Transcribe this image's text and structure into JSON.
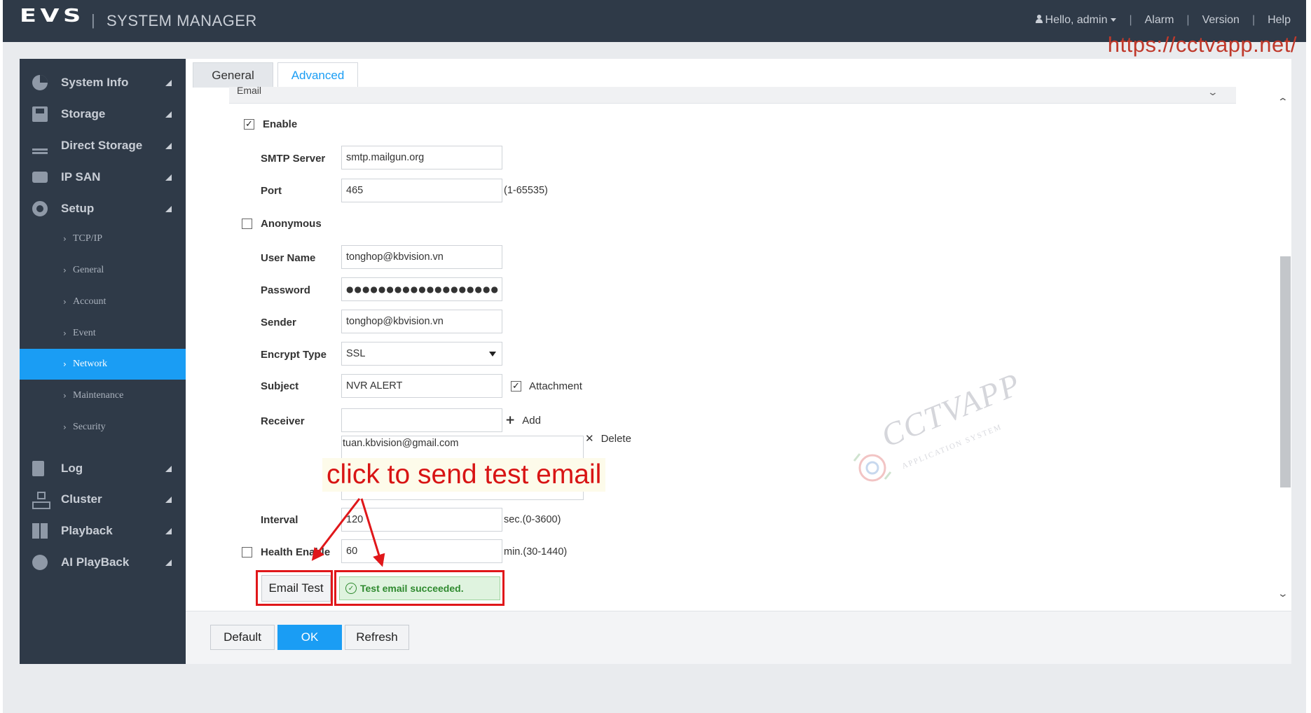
{
  "header": {
    "logo": "EVS",
    "separator": "|",
    "app_title": "SYSTEM MANAGER",
    "user_greeting": "Hello, admin",
    "pipe": "|",
    "links": [
      "Alarm",
      "Version",
      "Help"
    ]
  },
  "watermark_url": "https://cctvapp.net/",
  "watermark_brand": "CCTVAPP",
  "watermark_brand_sub": "APPLICATION SYSTEM",
  "sidebar": {
    "items": [
      {
        "label": "System Info",
        "icon": "pie-chart-icon"
      },
      {
        "label": "Storage",
        "icon": "storage-icon"
      },
      {
        "label": "Direct Storage",
        "icon": "direct-storage-icon"
      },
      {
        "label": "IP SAN",
        "icon": "hdd-icon"
      },
      {
        "label": "Setup",
        "icon": "gear-icon"
      }
    ],
    "setup_sub": [
      {
        "label": "TCP/IP"
      },
      {
        "label": "General"
      },
      {
        "label": "Account"
      },
      {
        "label": "Event"
      },
      {
        "label": "Network",
        "active": true
      },
      {
        "label": "Maintenance"
      },
      {
        "label": "Security"
      }
    ],
    "bottom_items": [
      {
        "label": "Log",
        "icon": "document-icon"
      },
      {
        "label": "Cluster",
        "icon": "cluster-icon"
      },
      {
        "label": "Playback",
        "icon": "playback-icon"
      },
      {
        "label": "AI PlayBack",
        "icon": "ai-playback-icon"
      }
    ],
    "chevron": "›"
  },
  "tabs": [
    "General",
    "Advanced"
  ],
  "section_title": "Email",
  "form": {
    "enable_label": "Enable",
    "enable_checked": true,
    "smtp_label": "SMTP Server",
    "smtp_value": "smtp.mailgun.org",
    "port_label": "Port",
    "port_value": "465",
    "port_hint": "(1-65535)",
    "anonymous_label": "Anonymous",
    "anonymous_checked": false,
    "username_label": "User Name",
    "username_value": "tonghop@kbvision.vn",
    "password_label": "Password",
    "password_value": "●●●●●●●●●●●●●●●●●●●",
    "sender_label": "Sender",
    "sender_value": "tonghop@kbvision.vn",
    "encrypt_label": "Encrypt Type",
    "encrypt_value": "SSL",
    "subject_label": "Subject",
    "subject_value": "NVR ALERT",
    "attachment_label": "Attachment",
    "attachment_checked": true,
    "receiver_label": "Receiver",
    "receiver_value": "",
    "add_label": "Add",
    "receivers": [
      "tuan.kbvision@gmail.com"
    ],
    "delete_label": "Delete",
    "interval_label": "Interval",
    "interval_value": "120",
    "interval_hint": "sec.(0-3600)",
    "health_label": "Health Enable",
    "health_checked": false,
    "health_value": "60",
    "health_hint": "min.(30-1440)",
    "email_test_label": "Email Test",
    "test_result": "Test email succeeded."
  },
  "footer": {
    "default_label": "Default",
    "ok_label": "OK",
    "refresh_label": "Refresh"
  },
  "annotation": {
    "text": "click to send test email",
    "color": "#e0171a"
  },
  "colors": {
    "accent": "#1a9df4",
    "topbar": "#2f3a48",
    "success": "#2f8a2f"
  }
}
